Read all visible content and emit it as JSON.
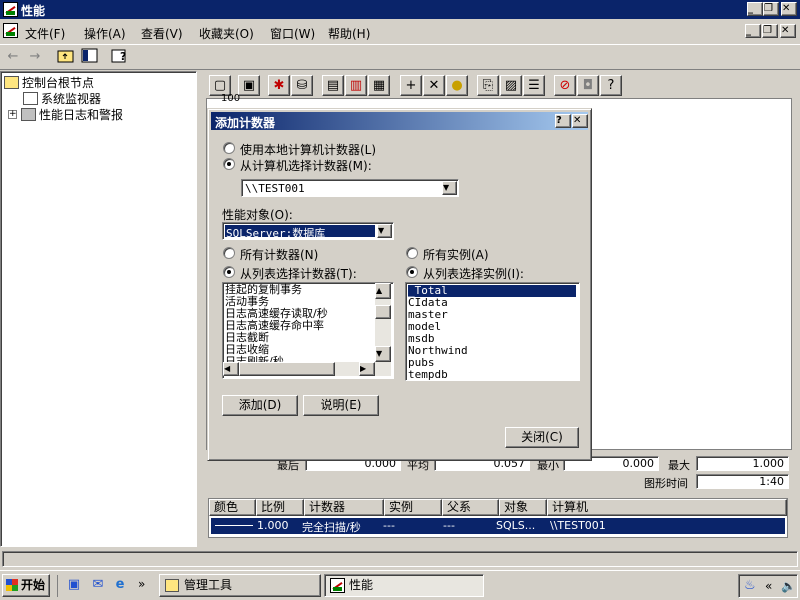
{
  "window": {
    "title": "性能",
    "caption_buttons": [
      "_",
      "❐",
      "✕"
    ]
  },
  "menu": {
    "items": [
      "文件(F)",
      "操作(A)",
      "查看(V)",
      "收藏夹(O)",
      "窗口(W)",
      "帮助(H)"
    ],
    "caption_buttons": [
      "_",
      "❐",
      "✕"
    ]
  },
  "tree": {
    "root": "控制台根节点",
    "items": [
      "系统监视器",
      "性能日志和警报"
    ]
  },
  "stats": {
    "last_label": "最后",
    "last_value": "0.000",
    "avg_label": "平均",
    "avg_value": "0.057",
    "min_label": "最小",
    "min_value": "0.000",
    "max_label": "最大",
    "max_value": "1.000",
    "duration_label": "图形时间",
    "duration_value": "1:40",
    "axis_fragment": "100"
  },
  "counter_table": {
    "headers": [
      "颜色",
      "比例",
      "计数器",
      "实例",
      "父系",
      "对象",
      "计算机"
    ],
    "row": {
      "scale": "1.000",
      "counter": "完全扫描/秒",
      "instance": "---",
      "parent": "---",
      "object": "SQLS...",
      "computer": "\\\\TEST001"
    }
  },
  "dialog": {
    "title": "添加计数器",
    "help_btn": "?",
    "close_btn": "✕",
    "radio_local": "使用本地计算机计数器(L)",
    "radio_select": "从计算机选择计数器(M):",
    "computer_value": "\\\\TEST001",
    "object_label": "性能对象(O):",
    "object_value": "SQLServer:数据库",
    "all_counters": "所有计数器(N)",
    "list_counters": "从列表选择计数器(T):",
    "all_instances": "所有实例(A)",
    "list_instances": "从列表选择实例(I):",
    "counters": [
      "挂起的复制事务",
      "活动事务",
      "日志高速缓存读取/秒",
      "日志高速缓存命中率",
      "日志截断",
      "日志收缩",
      "日志刷新/秒"
    ],
    "instances": [
      "_Total",
      "CIdata",
      "master",
      "model",
      "msdb",
      "Northwind",
      "pubs",
      "tempdb"
    ],
    "add_btn": "添加(D)",
    "explain_btn": "说明(E)",
    "close_label": "关闭(C)"
  },
  "taskbar": {
    "start": "开始",
    "tasks": [
      "管理工具",
      "性能"
    ],
    "chevron": "»",
    "tray_chevron": "«"
  },
  "colors": {
    "titlebar": "#0a246a",
    "selection": "#0a246a",
    "face": "#d4d0c8"
  }
}
